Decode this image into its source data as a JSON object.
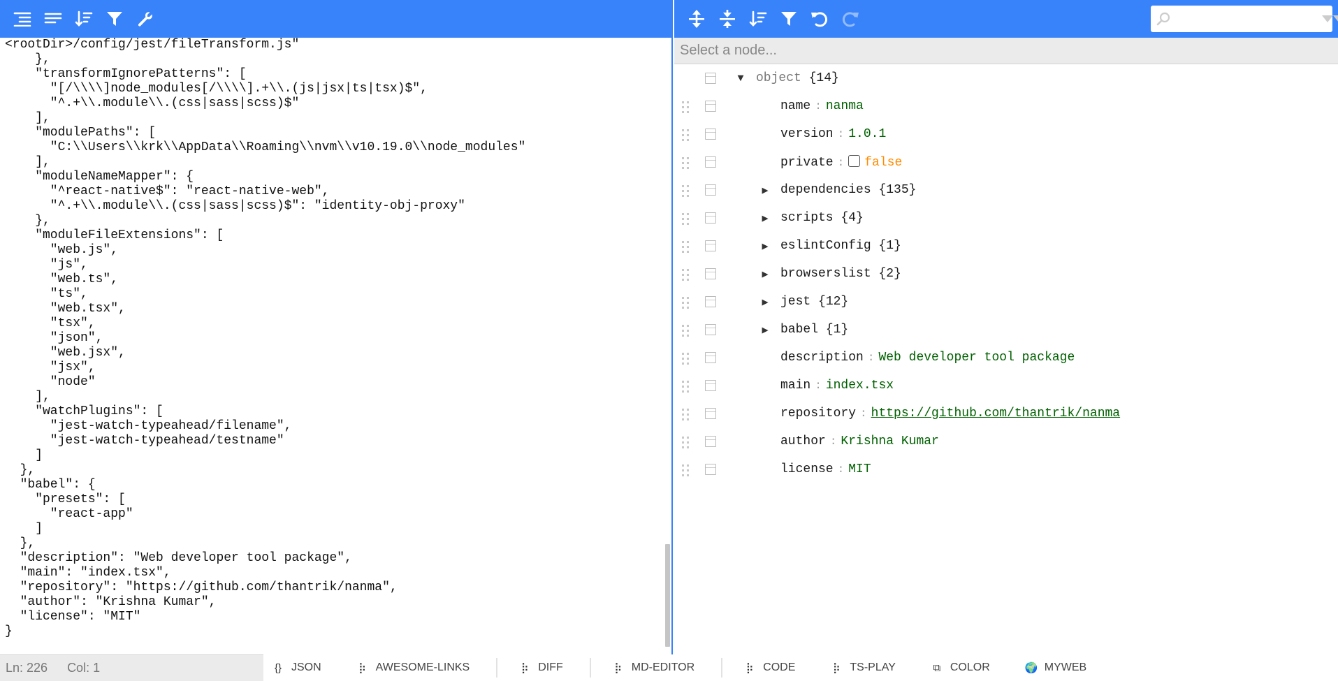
{
  "left_toolbar": {
    "icons": [
      "format-icon",
      "compact-icon",
      "sort-icon",
      "filter-icon",
      "repair-icon"
    ]
  },
  "code": {
    "lines": [
      "<rootDir>/config/jest/fileTransform.js\"",
      "    },",
      "    \"transformIgnorePatterns\": [",
      "      \"[/\\\\\\\\]node_modules[/\\\\\\\\].+\\\\.(js|jsx|ts|tsx)$\",",
      "      \"^.+\\\\.module\\\\.(css|sass|scss)$\"",
      "    ],",
      "    \"modulePaths\": [",
      "      \"C:\\\\Users\\\\krk\\\\AppData\\\\Roaming\\\\nvm\\\\v10.19.0\\\\node_modules\"",
      "    ],",
      "    \"moduleNameMapper\": {",
      "      \"^react-native$\": \"react-native-web\",",
      "      \"^.+\\\\.module\\\\.(css|sass|scss)$\": \"identity-obj-proxy\"",
      "    },",
      "    \"moduleFileExtensions\": [",
      "      \"web.js\",",
      "      \"js\",",
      "      \"web.ts\",",
      "      \"ts\",",
      "      \"web.tsx\",",
      "      \"tsx\",",
      "      \"json\",",
      "      \"web.jsx\",",
      "      \"jsx\",",
      "      \"node\"",
      "    ],",
      "    \"watchPlugins\": [",
      "      \"jest-watch-typeahead/filename\",",
      "      \"jest-watch-typeahead/testname\"",
      "    ]",
      "  },",
      "  \"babel\": {",
      "    \"presets\": [",
      "      \"react-app\"",
      "    ]",
      "  },",
      "  \"description\": \"Web developer tool package\",",
      "  \"main\": \"index.tsx\",",
      "  \"repository\": \"https://github.com/thantrik/nanma\",",
      "  \"author\": \"Krishna Kumar\",",
      "  \"license\": \"MIT\"",
      "}"
    ]
  },
  "status": {
    "line": "Ln: 226",
    "col": "Col: 1"
  },
  "right_toolbar": {
    "icons": [
      "expand-all-icon",
      "collapse-all-icon",
      "sort-icon",
      "filter-icon",
      "undo-icon",
      "redo-icon"
    ],
    "search_placeholder": ""
  },
  "nav": {
    "placeholder": "Select a node..."
  },
  "tree": {
    "root": {
      "label": "object",
      "count": "{14}"
    },
    "rows": [
      {
        "key": "name",
        "value": "nanma",
        "type": "string"
      },
      {
        "key": "version",
        "value": "1.0.1",
        "type": "string"
      },
      {
        "key": "private",
        "value": "false",
        "type": "boolean"
      },
      {
        "key": "dependencies",
        "count": "{135}",
        "type": "object"
      },
      {
        "key": "scripts",
        "count": "{4}",
        "type": "object"
      },
      {
        "key": "eslintConfig",
        "count": "{1}",
        "type": "object"
      },
      {
        "key": "browserslist",
        "count": "{2}",
        "type": "array"
      },
      {
        "key": "jest",
        "count": "{12}",
        "type": "object"
      },
      {
        "key": "babel",
        "count": "{1}",
        "type": "object"
      },
      {
        "key": "description",
        "value": "Web developer tool package",
        "type": "string"
      },
      {
        "key": "main",
        "value": "index.tsx",
        "type": "string"
      },
      {
        "key": "repository",
        "value": "https://github.com/thantrik/nanma",
        "type": "link"
      },
      {
        "key": "author",
        "value": "Krishna Kumar",
        "type": "string"
      },
      {
        "key": "license",
        "value": "MIT",
        "type": "string"
      }
    ]
  },
  "tabs": [
    {
      "icon": "json-icon",
      "glyph": "{}",
      "label": "JSON"
    },
    {
      "icon": "grid-icon",
      "glyph": "⡷",
      "label": "AWESOME-LINKS"
    },
    {
      "icon": "grid-icon",
      "glyph": "⡷",
      "label": "DIFF"
    },
    {
      "icon": "grid-icon",
      "glyph": "⡷",
      "label": "MD-EDITOR"
    },
    {
      "icon": "grid-icon",
      "glyph": "⡷",
      "label": "CODE"
    },
    {
      "icon": "grid-icon",
      "glyph": "⡷",
      "label": "TS-PLAY"
    },
    {
      "icon": "color-icon",
      "glyph": "⧉",
      "label": "COLOR"
    },
    {
      "icon": "globe-icon",
      "glyph": "🌍",
      "label": "MYWEB"
    }
  ],
  "colors": {
    "accent": "#3883fa",
    "string": "#006000",
    "boolean": "#ff8c00",
    "bar": "#ebebeb"
  }
}
